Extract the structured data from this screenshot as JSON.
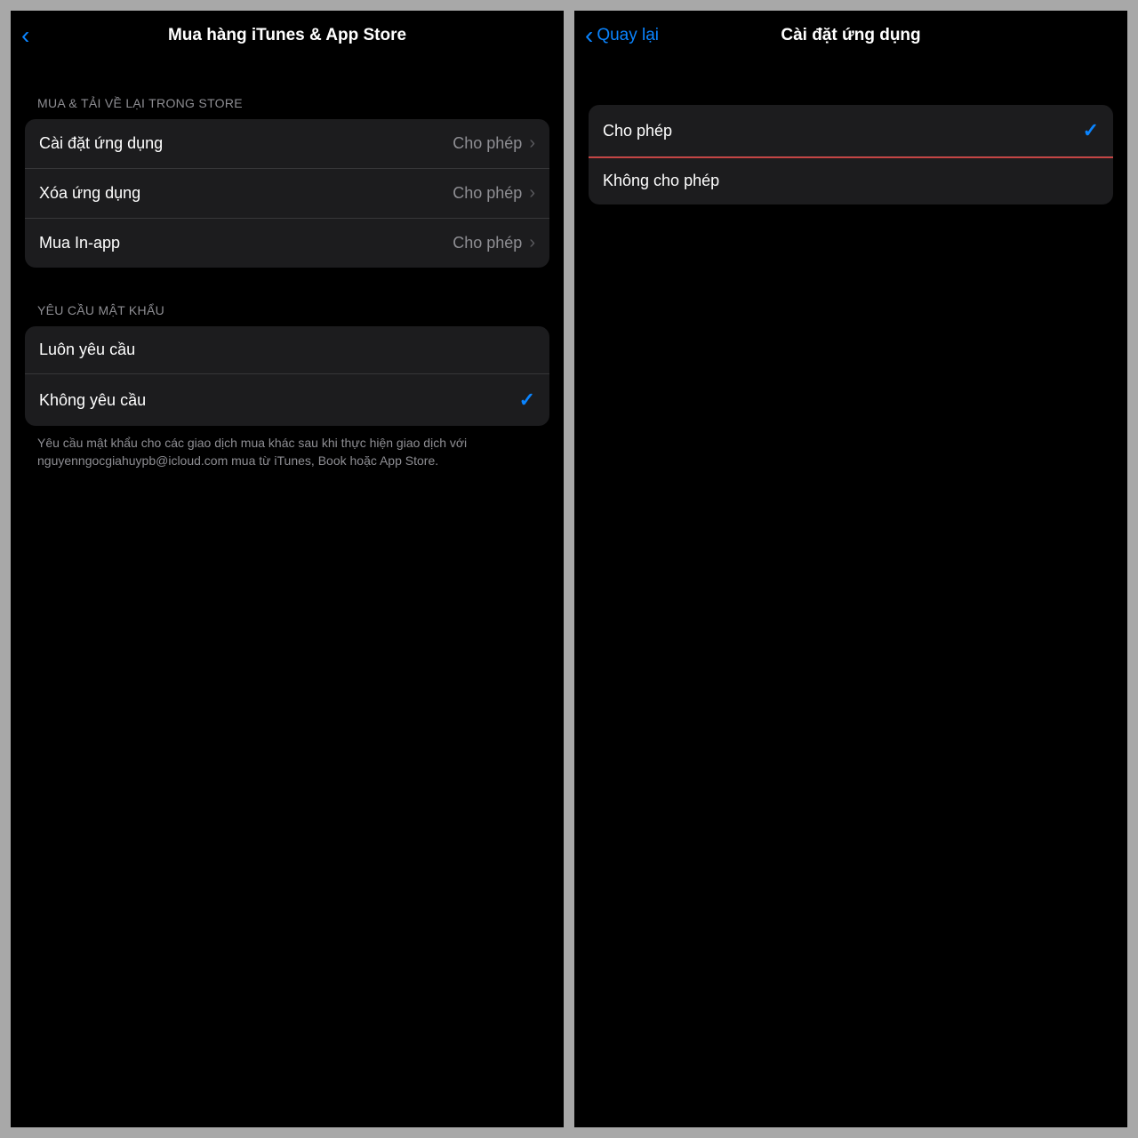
{
  "left": {
    "nav_title": "Mua hàng iTunes & App Store",
    "section1_header": "MUA & TẢI VỀ LẠI TRONG STORE",
    "rows1": [
      {
        "label": "Cài đặt ứng dụng",
        "value": "Cho phép"
      },
      {
        "label": "Xóa ứng dụng",
        "value": "Cho phép"
      },
      {
        "label": "Mua In-app",
        "value": "Cho phép"
      }
    ],
    "section2_header": "YÊU CẦU MẬT KHẨU",
    "rows2": [
      {
        "label": "Luôn yêu cầu",
        "selected": false
      },
      {
        "label": "Không yêu cầu",
        "selected": true
      }
    ],
    "footer": "Yêu cầu mật khẩu cho các giao dịch mua khác sau khi thực hiện giao dịch với nguyenngocgiahuypb@icloud.com mua từ iTunes, Book hoặc App Store."
  },
  "right": {
    "back_label": "Quay lại",
    "nav_title": "Cài đặt ứng dụng",
    "rows": [
      {
        "label": "Cho phép",
        "selected": true,
        "highlight": true
      },
      {
        "label": "Không cho phép",
        "selected": false
      }
    ]
  }
}
